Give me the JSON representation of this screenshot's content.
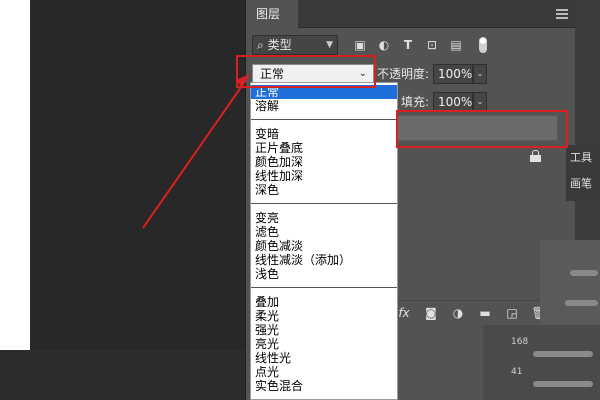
{
  "layers_panel": {
    "tab_label": "图层",
    "filter": {
      "label": "类型",
      "icons": [
        "image-icon",
        "adjustment-icon",
        "text-icon",
        "shape-icon",
        "smart-object-icon"
      ]
    },
    "blend_mode_value": "正常",
    "opacity_label": "不透明度:",
    "opacity_value": "100%",
    "fill_label": "填充:",
    "fill_value": "100%",
    "footer_icons": [
      "fx-icon",
      "mask-icon",
      "adjustment-layer-icon",
      "folder-icon",
      "new-layer-icon",
      "trash-icon"
    ],
    "footer_fx_label": "fx"
  },
  "blend_dropdown": {
    "groups": [
      [
        "正常",
        "溶解"
      ],
      [
        "变暗",
        "正片叠底",
        "颜色加深",
        "线性加深",
        "深色"
      ],
      [
        "变亮",
        "滤色",
        "颜色减淡",
        "线性减淡（添加）",
        "浅色"
      ],
      [
        "叠加",
        "柔光",
        "强光",
        "亮光",
        "线性光",
        "点光",
        "实色混合"
      ]
    ],
    "selected": "正常"
  },
  "right_panels": {
    "tab_tool": "工具",
    "tab_brush": "画笔",
    "brush_sizes": [
      "168",
      "41"
    ]
  },
  "annotation": {
    "color": "#d92020"
  },
  "colors": {
    "selection": "#1e6fd9",
    "panel": "#535353",
    "background": "#282828"
  }
}
